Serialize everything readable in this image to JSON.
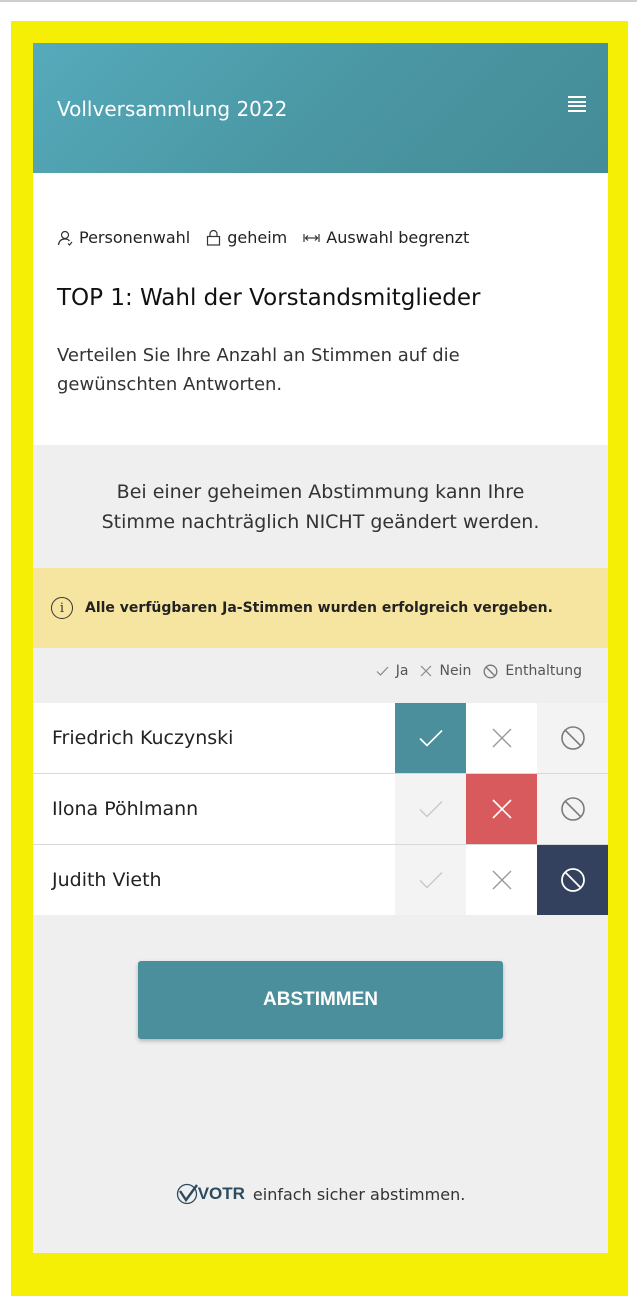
{
  "header": {
    "title": "Vollversammlung 2022"
  },
  "tags": [
    {
      "label": "Personenwahl",
      "icon": "person-icon"
    },
    {
      "label": "geheim",
      "icon": "lock-icon"
    },
    {
      "label": "Auswahl begrenzt",
      "icon": "range-icon"
    }
  ],
  "question": {
    "title": "TOP 1: Wahl der Vorstandsmitglieder",
    "description": "Verteilen Sie Ihre Anzahl an Stimmen auf die gewünschten Antworten."
  },
  "secret_note": "Bei einer geheimen Abstimmung kann Ihre Stimme nachträglich NICHT geändert werden.",
  "success_banner": "Alle verfügbaren Ja-Stimmen wurden erfolgreich vergeben.",
  "legend": {
    "yes": "Ja",
    "no": "Nein",
    "abstain": "Enthaltung"
  },
  "candidates": [
    {
      "name": "Friedrich Kuczynski",
      "selected": "yes"
    },
    {
      "name": "Ilona Pöhlmann",
      "selected": "no"
    },
    {
      "name": "Judith Vieth",
      "selected": "abstain"
    }
  ],
  "submit_label": "ABSTIMMEN",
  "footer": {
    "brand": "VOTR",
    "tagline": "einfach sicher abstimmen."
  },
  "colors": {
    "header": "#4a96a2",
    "yes_active": "#4a8f9b",
    "no_active": "#d95a5d",
    "abstain_active": "#33415e",
    "banner": "#f6e5a1",
    "frame": "#f5ef06"
  }
}
